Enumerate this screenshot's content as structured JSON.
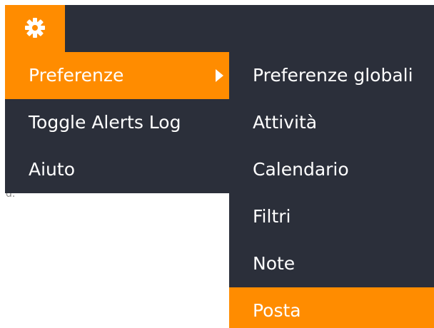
{
  "colors": {
    "accent": "#ff8c00",
    "menu_bg": "#2b2f3a",
    "text": "#ffffff"
  },
  "settings_button": {
    "icon": "gear-icon"
  },
  "menu": {
    "items": [
      {
        "label": "Preferenze",
        "active": true,
        "has_submenu": true
      },
      {
        "label": "Toggle Alerts Log"
      },
      {
        "label": "Aiuto"
      }
    ]
  },
  "submenu": {
    "items": [
      {
        "label": "Preferenze globali"
      },
      {
        "label": "Attività"
      },
      {
        "label": "Calendario"
      },
      {
        "label": "Filtri"
      },
      {
        "label": "Note"
      },
      {
        "label": "Posta",
        "active": true
      }
    ]
  },
  "background_fragment": "d."
}
